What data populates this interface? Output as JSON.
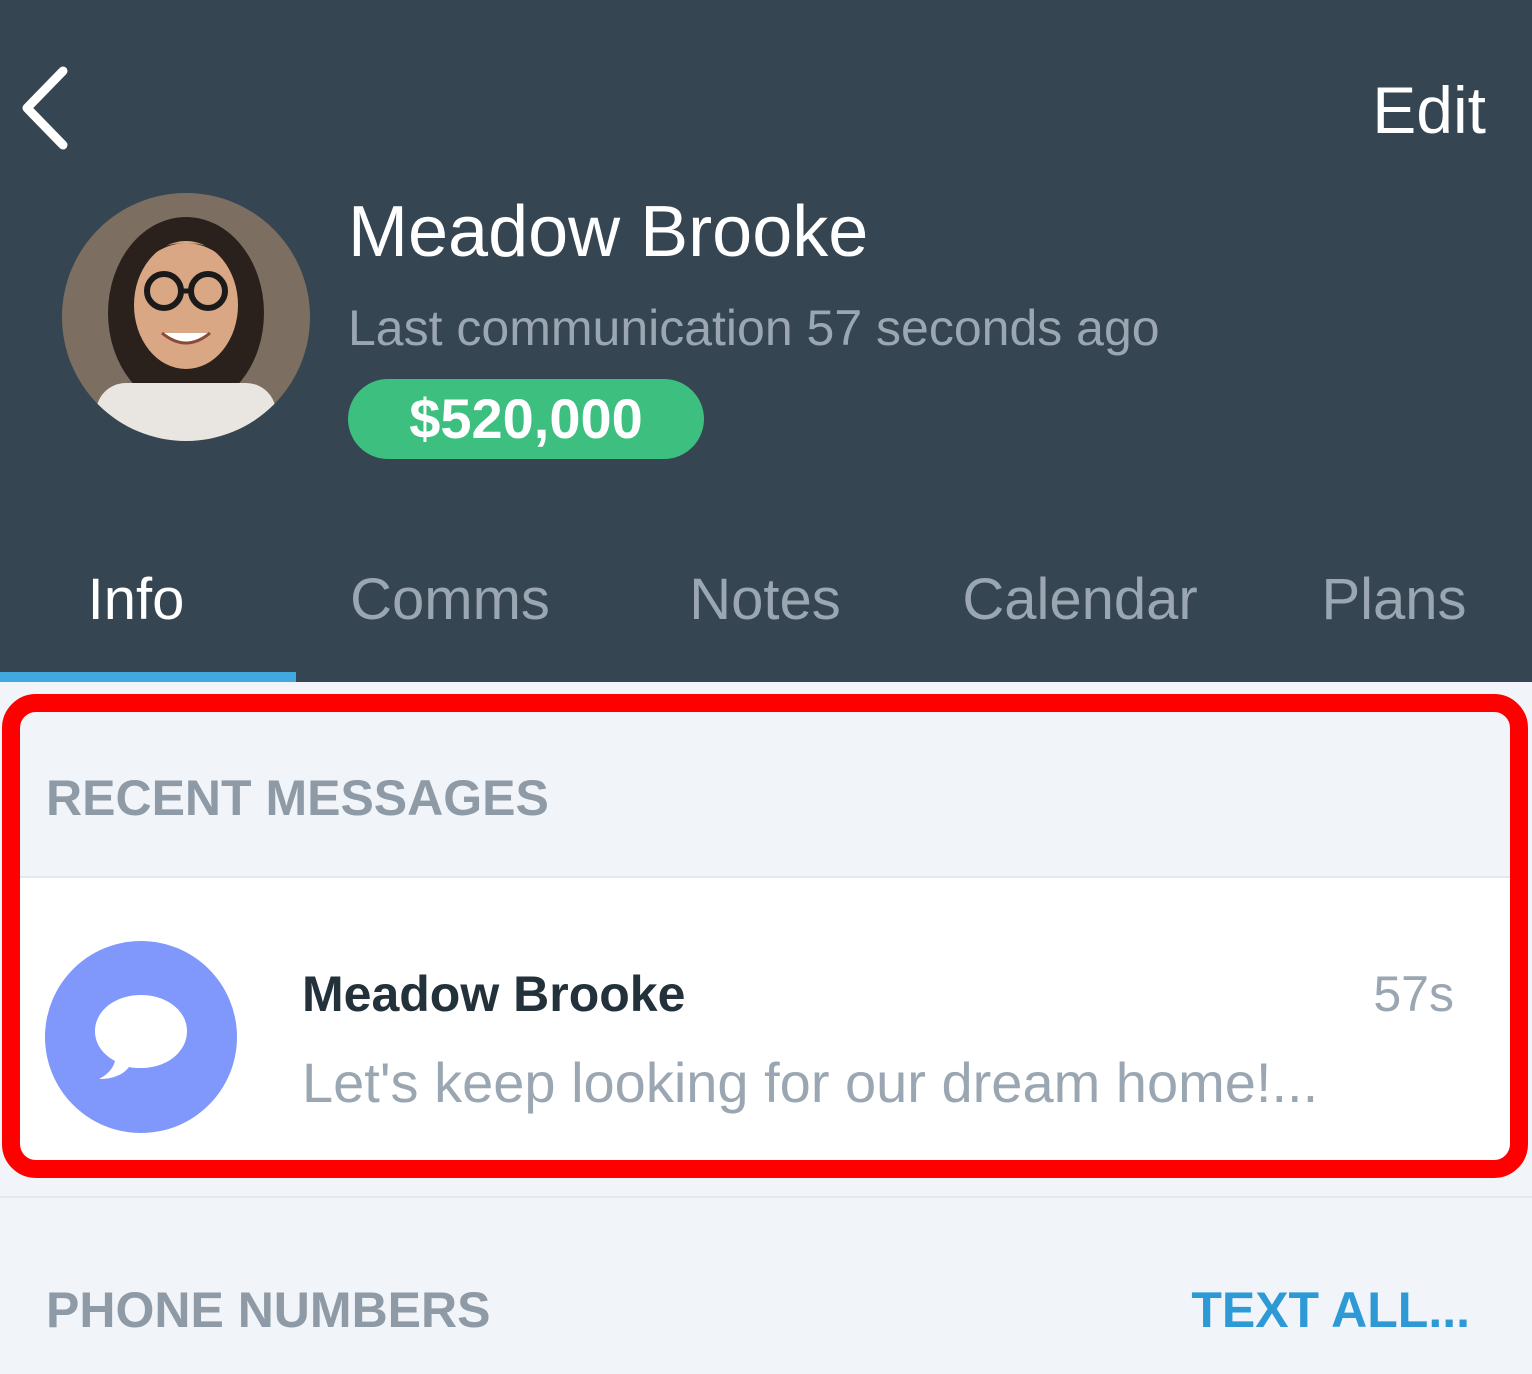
{
  "header": {
    "back_icon": "chevron-left-icon",
    "edit_label": "Edit",
    "contact": {
      "name": "Meadow Brooke",
      "last_communication": "Last communication 57 seconds ago",
      "price": "$520,000"
    }
  },
  "tabs": [
    {
      "label": "Info",
      "active": true
    },
    {
      "label": "Comms",
      "active": false
    },
    {
      "label": "Notes",
      "active": false
    },
    {
      "label": "Calendar",
      "active": false
    },
    {
      "label": "Plans",
      "active": false
    }
  ],
  "recent_messages": {
    "title": "RECENT MESSAGES",
    "items": [
      {
        "icon": "chat-bubble-icon",
        "sender": "Meadow Brooke",
        "time": "57s",
        "preview": "Let's keep looking for our dream home!..."
      }
    ]
  },
  "phone_numbers": {
    "title": "PHONE NUMBERS",
    "action_label": "TEXT ALL..."
  },
  "colors": {
    "header_bg": "#354551",
    "accent_blue": "#3fa9e0",
    "price_green": "#3dbf7f",
    "highlight_red": "#ff0000",
    "message_icon_bg": "#8098fb"
  }
}
